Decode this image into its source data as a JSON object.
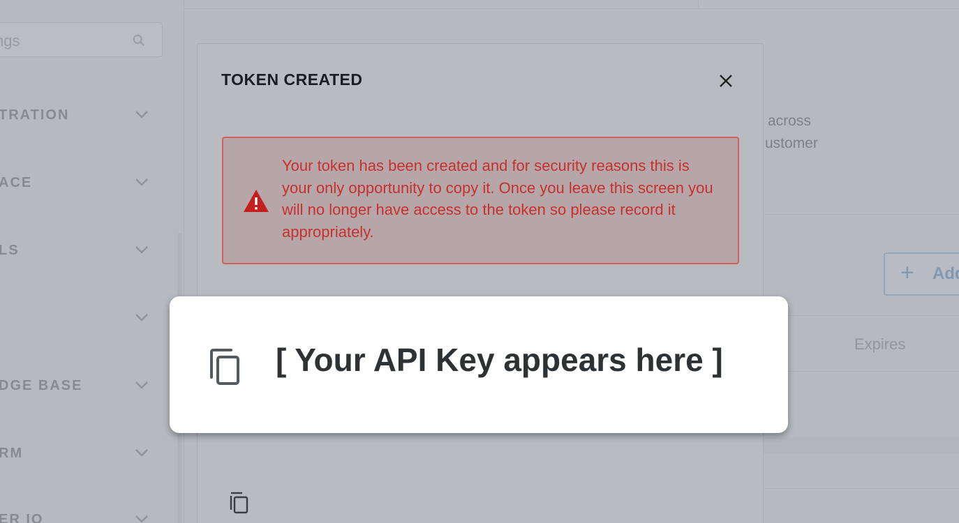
{
  "sidebar": {
    "search_placeholder": "ngs",
    "items": [
      {
        "label": "TRATION"
      },
      {
        "label": "ACE"
      },
      {
        "label": "LS"
      },
      {
        "label": ""
      },
      {
        "label": "DGE BASE"
      },
      {
        "label": "RM"
      },
      {
        "label": "ER IO"
      }
    ]
  },
  "background": {
    "description_line1": "across",
    "description_line2": "ustomer",
    "add_button_label": "Add",
    "table_header_expires": "Expires"
  },
  "modal": {
    "title": "TOKEN CREATED",
    "alert_text": "Your token has been created and for security reasons this is your only opportunity to copy it. Once you leave this screen you will no longer have access to the token so please record it appropriately."
  },
  "key_card": {
    "text": "[ Your API Key appears here ]"
  },
  "colors": {
    "alert_red": "#c6302f",
    "accent_blue": "#86a8cf"
  }
}
